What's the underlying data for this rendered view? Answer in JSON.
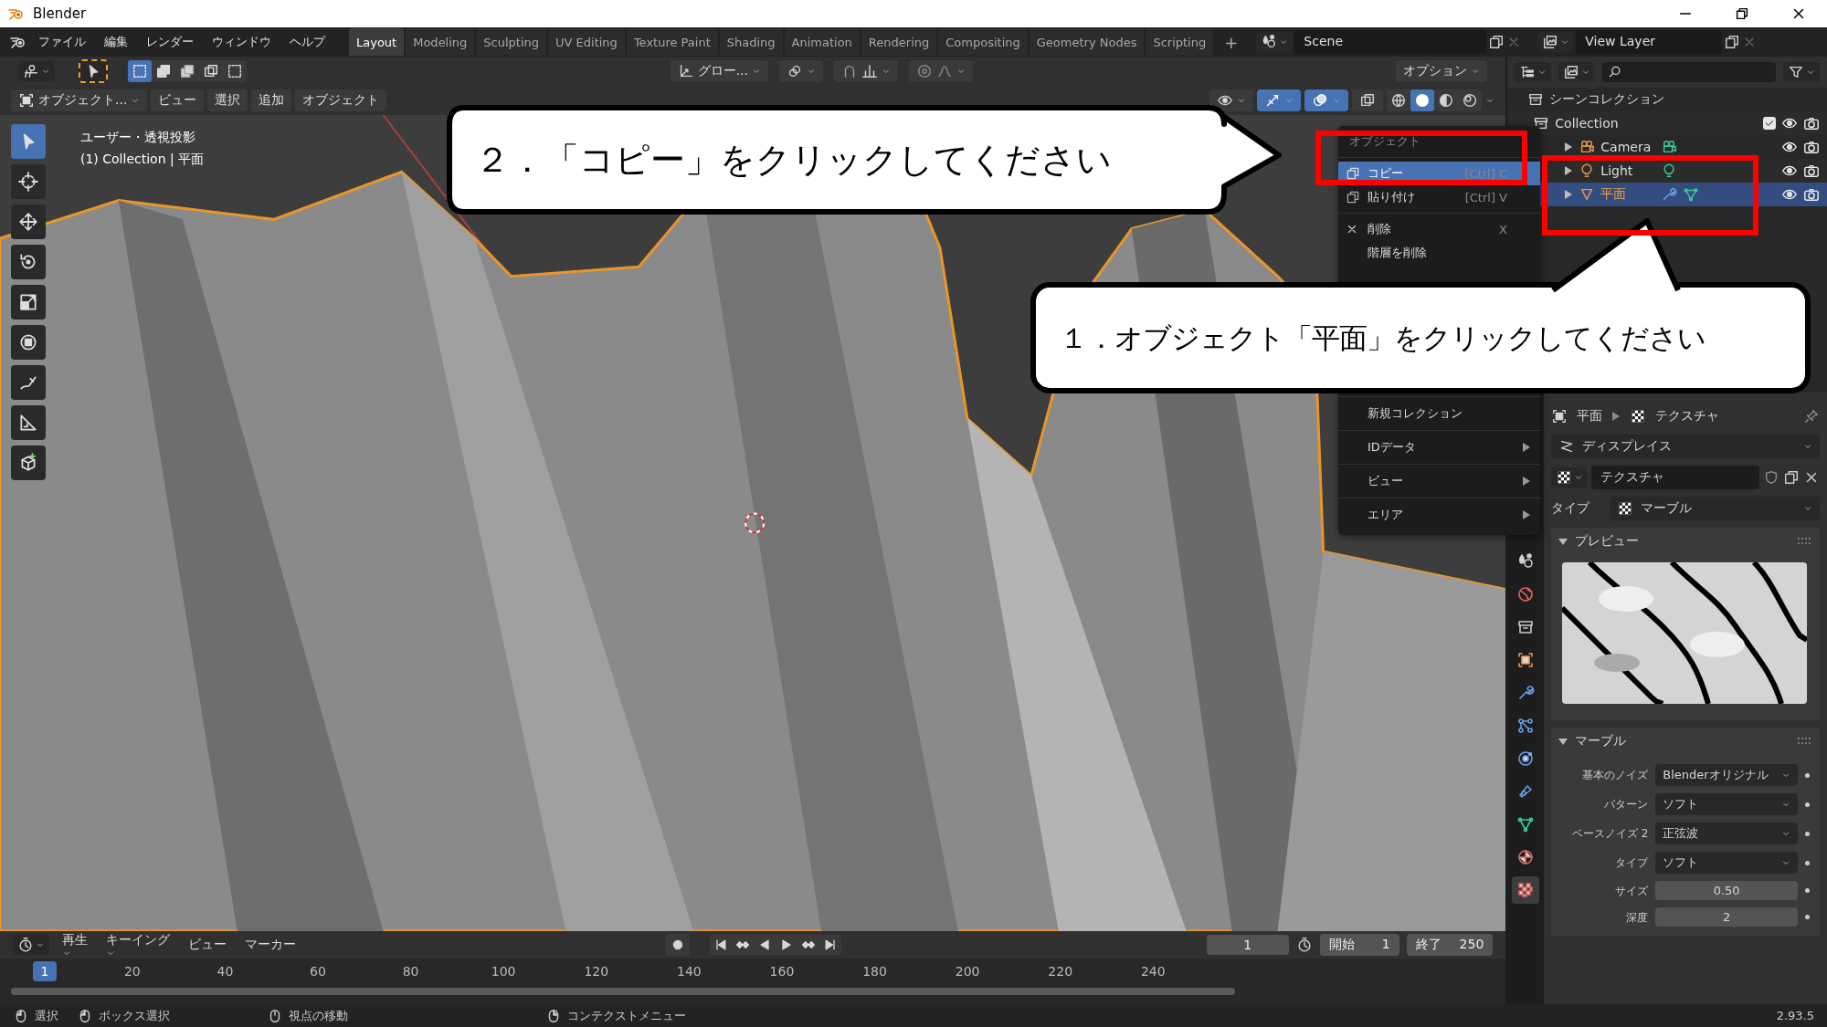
{
  "window": {
    "title": "Blender"
  },
  "menu": [
    "ファイル",
    "編集",
    "レンダー",
    "ウィンドウ",
    "ヘルプ"
  ],
  "workspaces": [
    {
      "label": "Layout",
      "selected": true
    },
    {
      "label": "Modeling",
      "selected": false
    },
    {
      "label": "Sculpting",
      "selected": false
    },
    {
      "label": "UV Editing",
      "selected": false
    },
    {
      "label": "Texture Paint",
      "selected": false
    },
    {
      "label": "Shading",
      "selected": false
    },
    {
      "label": "Animation",
      "selected": false
    },
    {
      "label": "Rendering",
      "selected": false
    },
    {
      "label": "Compositing",
      "selected": false
    },
    {
      "label": "Geometry Nodes",
      "selected": false
    },
    {
      "label": "Scripting",
      "selected": false
    }
  ],
  "add_tab": "+",
  "scene": "Scene",
  "view_layer": "View Layer",
  "tool_header": {
    "orientation": "グロー...",
    "options": "オプション"
  },
  "viewport_header": {
    "mode": "オブジェクト...",
    "menus": [
      "ビュー",
      "選択",
      "追加",
      "オブジェクト"
    ],
    "gizmos_on": true,
    "overlays_on": true
  },
  "viewport": {
    "view_name": "ユーザー・透視投影",
    "object_info": "(1) Collection | 平面"
  },
  "tools": [
    {
      "selected": true
    },
    {
      "selected": false
    },
    {
      "selected": false
    },
    {
      "selected": false
    },
    {
      "selected": false
    },
    {
      "selected": false
    },
    {
      "selected": false
    },
    {
      "selected": false
    },
    {
      "selected": false
    }
  ],
  "context_menu": {
    "title": "オブジェクト",
    "sections": [
      [
        {
          "label": "コピー",
          "shortcut": "[Ctrl] C",
          "selected": true,
          "submenu": false
        },
        {
          "label": "貼り付け",
          "shortcut": "[Ctrl] V",
          "selected": false,
          "submenu": false
        }
      ],
      [
        {
          "label": "削除",
          "shortcut": "X",
          "selected": false,
          "submenu": false
        },
        {
          "label": "階層を削除",
          "selected": false,
          "submenu": false
        }
      ],
      [
        {
          "label": "新規コレクション",
          "selected": false,
          "submenu": false
        }
      ],
      [
        {
          "label": "IDデータ",
          "selected": false,
          "submenu": true
        }
      ],
      [
        {
          "label": "ビュー",
          "selected": false,
          "submenu": true
        }
      ],
      [
        {
          "label": "エリア",
          "selected": false,
          "submenu": true
        }
      ]
    ]
  },
  "callouts": [
    {
      "text": "２．「コピー」をクリックしてください"
    },
    {
      "text": "１．オブジェクト「平面」をクリックしてください"
    }
  ],
  "outliner": {
    "root": "シーンコレクション",
    "items": [
      {
        "name": "Collection",
        "kind": "collection",
        "checked": true,
        "selected": false,
        "children": [
          {
            "name": "Camera",
            "kind": "camera",
            "expanded": false,
            "selected": false
          },
          {
            "name": "Light",
            "kind": "light",
            "expanded": false,
            "selected": false
          },
          {
            "name": "平面",
            "kind": "mesh",
            "expanded": false,
            "selected": true
          }
        ]
      }
    ]
  },
  "property_tabs": [
    {
      "selected": false
    },
    {
      "selected": false
    },
    {
      "selected": false
    },
    {
      "selected": false
    },
    {
      "selected": false
    },
    {
      "selected": false
    },
    {
      "selected": false
    },
    {
      "selected": false
    },
    {
      "selected": false
    },
    {
      "selected": false
    },
    {
      "selected": true
    }
  ],
  "properties": {
    "breadcrumb": [
      "平面",
      "テクスチャ"
    ],
    "modifier": "ディスプレイス",
    "texture_name": "テクスチャ",
    "type_label": "タイプ",
    "type_value": "マーブル",
    "preview_title": "プレビュー",
    "marble_title": "マーブル",
    "fields": [
      {
        "label": "基本のノイズ",
        "value": "Blenderオリジナル",
        "kind": "dropdown"
      },
      {
        "label": "パターン",
        "value": "ソフト",
        "kind": "dropdown"
      },
      {
        "label": "ベースノイズ 2",
        "value": "正弦波",
        "kind": "dropdown"
      },
      {
        "label": "タイプ",
        "value": "ソフト",
        "kind": "dropdown"
      },
      {
        "label": "サイズ",
        "value": "0.50",
        "kind": "number"
      },
      {
        "label": "深度",
        "value": "2",
        "kind": "number"
      }
    ]
  },
  "timeline": {
    "menus": [
      "再生",
      "キーイング",
      "ビュー",
      "マーカー"
    ],
    "current_frame": "1",
    "start_label": "開始",
    "start": "1",
    "end_label": "終了",
    "end": "250",
    "playhead": "1",
    "ticks": [
      "20",
      "40",
      "60",
      "80",
      "100",
      "120",
      "140",
      "160",
      "180",
      "200",
      "220",
      "240"
    ]
  },
  "status_bar": {
    "hints": [
      "選択",
      "ボックス選択",
      "視点の移動",
      "コンテクストメニュー"
    ],
    "version": "2.93.5"
  }
}
